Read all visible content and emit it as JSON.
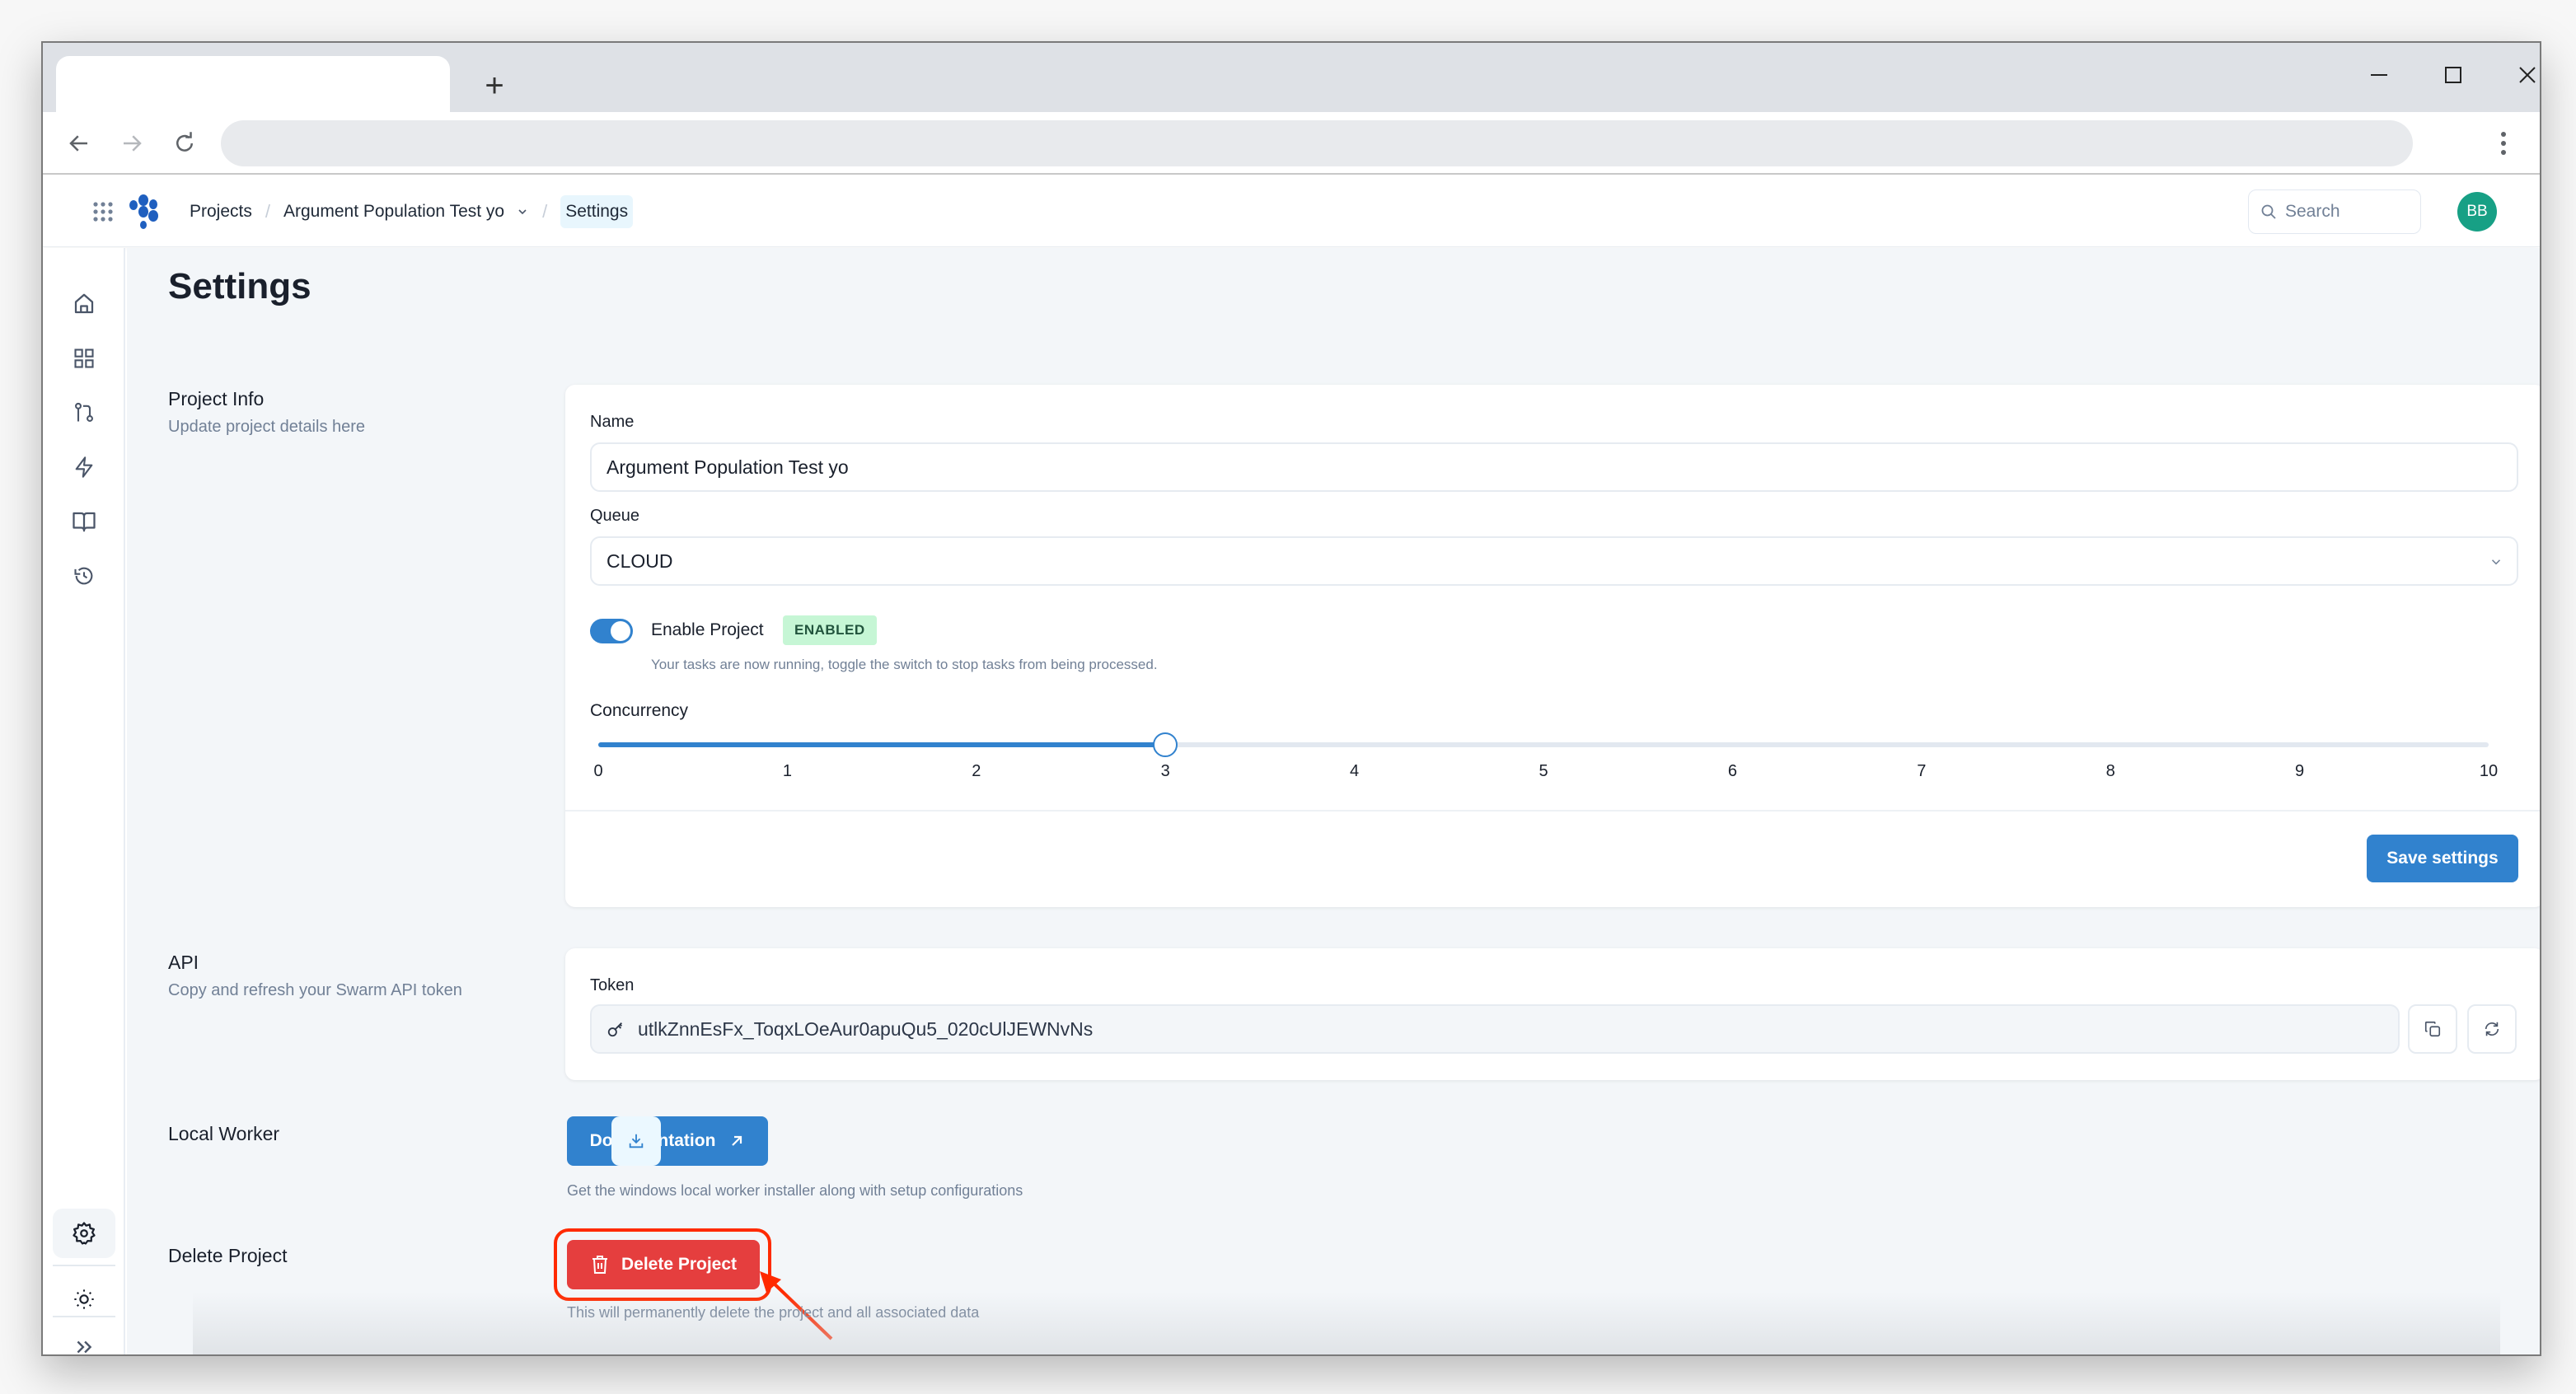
{
  "browser": {
    "new_tab_label": "+",
    "window_controls": [
      "minimize-icon",
      "maximize-icon",
      "close-icon"
    ],
    "nav": [
      "back-icon",
      "forward-icon",
      "reload-icon"
    ],
    "address": ""
  },
  "header": {
    "apps_icon": "grid-dots-icon",
    "logo_icon": "swarm-logo-icon",
    "breadcrumb": [
      {
        "label": "Projects"
      },
      {
        "label": "Argument Population Test yo",
        "has_dropdown": true
      },
      {
        "label": "Settings",
        "active": true
      }
    ],
    "search_placeholder": "Search",
    "avatar_initials": "BB",
    "avatar_color": "#17a085"
  },
  "sidebar": {
    "items": [
      {
        "icon": "home-icon"
      },
      {
        "icon": "dashboard-grid-icon"
      },
      {
        "icon": "git-pull-request-icon"
      },
      {
        "icon": "lightning-icon"
      },
      {
        "icon": "book-icon"
      },
      {
        "icon": "history-icon"
      }
    ],
    "bottom_items": [
      {
        "icon": "settings-gear-icon",
        "active": true
      },
      {
        "icon": "sun-icon"
      },
      {
        "icon": "expand-chevrons-icon"
      }
    ]
  },
  "page": {
    "title": "Settings",
    "project_info": {
      "title": "Project Info",
      "description": "Update project details here",
      "name_label": "Name",
      "name_value": "Argument Population Test yo",
      "queue_label": "Queue",
      "queue_value": "CLOUD",
      "enable_label": "Enable Project",
      "enable_state": true,
      "enable_badge": "ENABLED",
      "enable_hint": "Your tasks are now running, toggle the switch to stop tasks from being processed.",
      "concurrency_label": "Concurrency",
      "concurrency_value": 3,
      "concurrency_min": 0,
      "concurrency_max": 10,
      "concurrency_ticks": [
        "0",
        "1",
        "2",
        "3",
        "4",
        "5",
        "6",
        "7",
        "8",
        "9",
        "10"
      ],
      "save_label": "Save settings"
    },
    "api": {
      "title": "API",
      "description": "Copy and refresh your Swarm API token",
      "token_label": "Token",
      "token_value": "utlkZnnEsFx_ToqxLOeAur0apuQu5_020cUlJEWNvNs"
    },
    "local_worker": {
      "title": "Local Worker",
      "docs_label": "Documentation",
      "hint": "Get the windows local worker installer along with setup configurations"
    },
    "delete_project": {
      "title": "Delete Project",
      "button_label": "Delete Project",
      "hint": "This will permanently delete the project and all associated data"
    }
  },
  "colors": {
    "primary": "#3182ce",
    "danger": "#e53e3e",
    "annotation": "#ff2a00",
    "success_bg": "#c6f6d5",
    "success_text": "#22543d"
  }
}
